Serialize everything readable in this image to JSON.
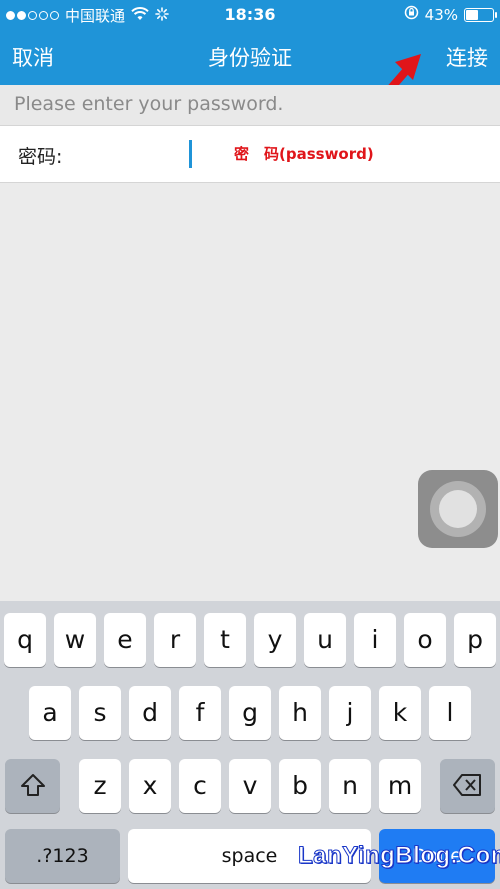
{
  "status_bar": {
    "carrier": "中国联通",
    "time": "18:36",
    "battery_percent": "43%",
    "battery_level": 0.43,
    "signal_bars_filled": 2,
    "signal_bars_total": 5
  },
  "nav": {
    "cancel_label": "取消",
    "title": "身份验证",
    "connect_label": "连接"
  },
  "hint": "Please enter your password.",
  "password_field": {
    "label": "密码:",
    "annotation": "密　码(password)"
  },
  "keyboard": {
    "row1": [
      "q",
      "w",
      "e",
      "r",
      "t",
      "y",
      "u",
      "i",
      "o",
      "p"
    ],
    "row2": [
      "a",
      "s",
      "d",
      "f",
      "g",
      "h",
      "j",
      "k",
      "l"
    ],
    "row3": [
      "z",
      "x",
      "c",
      "v",
      "b",
      "n",
      "m"
    ],
    "numbers_label": ".?123",
    "space_label": "space",
    "done_label": "Done"
  },
  "watermark": "LanYingBlog.Com",
  "colors": {
    "header_blue": "#1f94d8",
    "annotation_red": "#e0151a",
    "done_blue": "#1f7cf3"
  }
}
